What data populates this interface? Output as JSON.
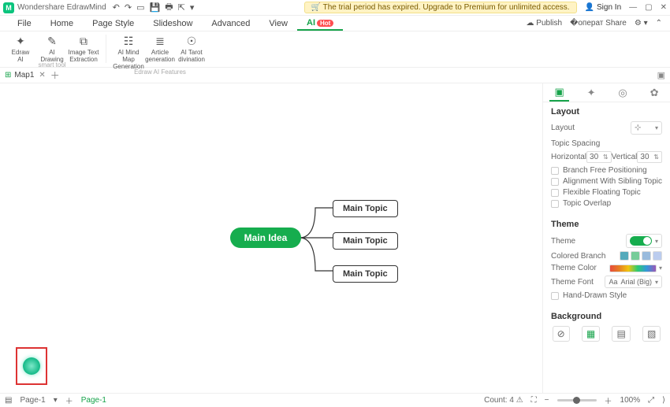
{
  "app": {
    "name": "Wondershare EdrawMind"
  },
  "trial_banner": "The trial period has expired. Upgrade to Premium for unlimited access.",
  "signin": "Sign In",
  "menubar": {
    "tabs": [
      "File",
      "Home",
      "Page Style",
      "Slideshow",
      "Advanced",
      "View",
      "AI"
    ],
    "ai_badge": "Hot",
    "right": {
      "publish": "Publish",
      "share": "Share"
    }
  },
  "ribbon": {
    "items": [
      {
        "icon": "✦",
        "label": "Edraw\nAI"
      },
      {
        "icon": "✎",
        "label": "AI\nDrawing"
      },
      {
        "icon": "⧉",
        "label": "Image Text\nExtraction"
      },
      {
        "icon": "☷",
        "label": "AI Mind Map\nGeneration"
      },
      {
        "icon": "≣",
        "label": "Article\ngeneration"
      },
      {
        "icon": "☉",
        "label": "AI Tarot\ndivination"
      }
    ],
    "group1": "smart tool",
    "group2": "Edraw AI Features"
  },
  "file_tab": "Map1",
  "mindmap": {
    "idea": "Main Idea",
    "topics": [
      "Main Topic",
      "Main Topic",
      "Main Topic"
    ]
  },
  "side": {
    "layout": {
      "title": "Layout",
      "layout_label": "Layout",
      "spacing": "Topic Spacing",
      "horizontal": "Horizontal",
      "h_val": "30",
      "vertical": "Vertical",
      "v_val": "30",
      "checks": [
        "Branch Free Positioning",
        "Alignment With Sibling Topic",
        "Flexible Floating Topic",
        "Topic Overlap"
      ]
    },
    "theme": {
      "title": "Theme",
      "theme_label": "Theme",
      "colored": "Colored Branch",
      "color": "Theme Color",
      "font": "Theme Font",
      "font_val": "Arial (Big)",
      "hand": "Hand-Drawn Style"
    },
    "background": {
      "title": "Background"
    }
  },
  "status": {
    "page": "Page-1",
    "page2": "Page-1",
    "count": "Count: 4",
    "zoom": "100%"
  }
}
